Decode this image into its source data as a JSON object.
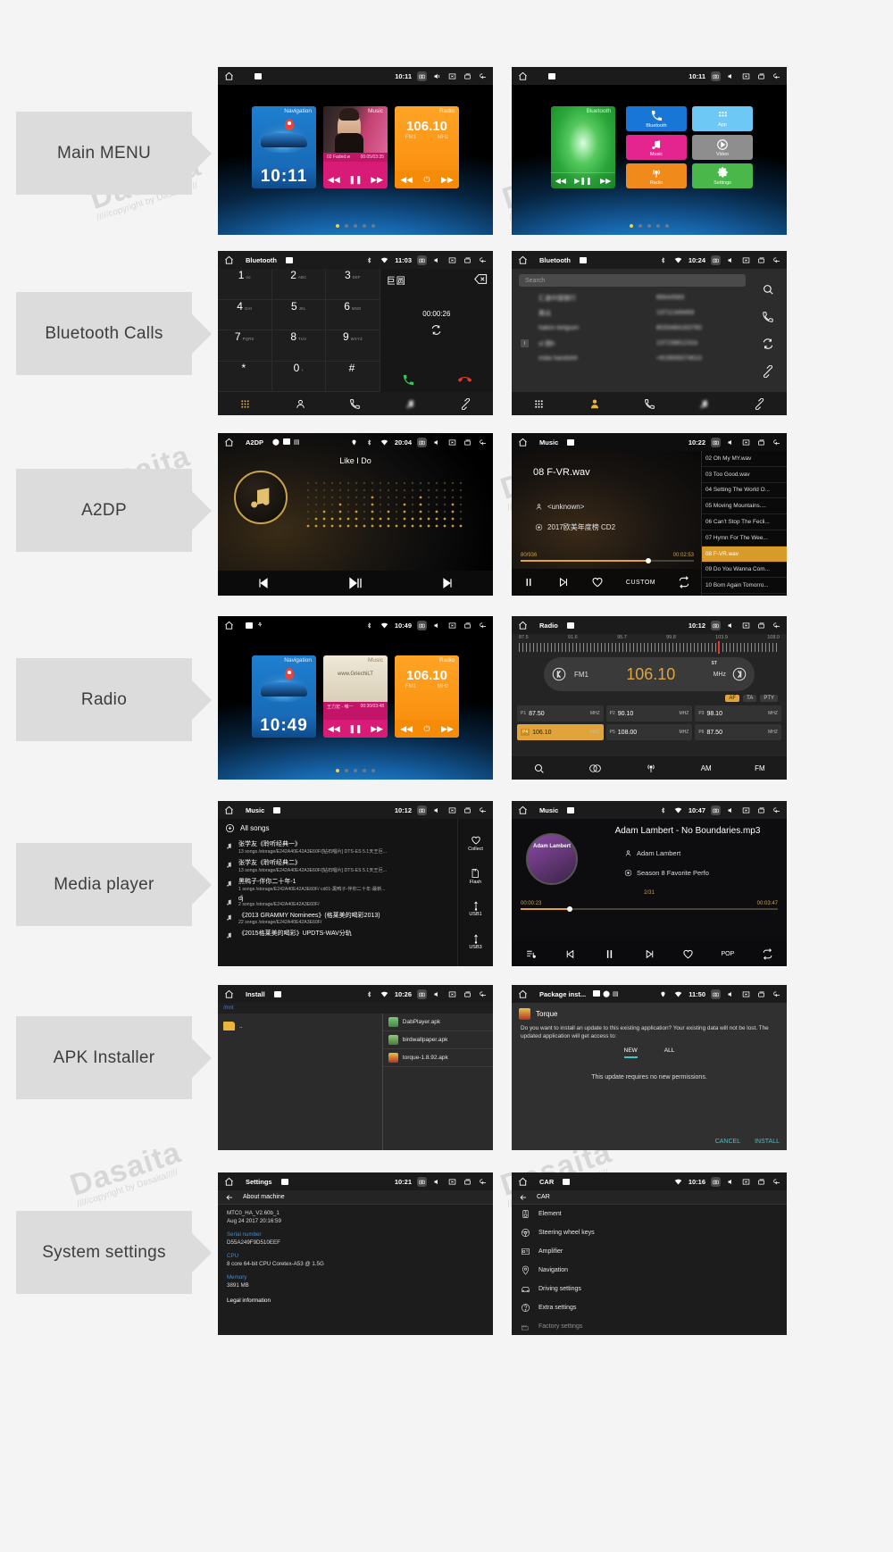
{
  "watermark": {
    "brand": "Dasaita",
    "note": "/////copyright by Dasaita/////"
  },
  "sections": [
    {
      "label": "Main MENU"
    },
    {
      "label": "Bluetooth Calls"
    },
    {
      "label": "A2DP"
    },
    {
      "label": "Radio"
    },
    {
      "label": "Media player"
    },
    {
      "label": "APK Installer"
    },
    {
      "label": "System settings"
    }
  ],
  "screens": {
    "main_menu_1": {
      "status": {
        "title": "",
        "clock": "10:11"
      },
      "widgets": {
        "navigation": {
          "label": "Navigation",
          "clock": "10:11"
        },
        "music": {
          "label": "Music",
          "track": "02 Faded.w",
          "time": "00:05/03:35"
        },
        "radio": {
          "label": "Radio",
          "freq": "106.10",
          "band": "FM1",
          "unit": "MHz"
        }
      },
      "pager": {
        "count": 5,
        "active": 1
      }
    },
    "main_menu_2": {
      "status": {
        "title": "",
        "clock": "10:11"
      },
      "bt_widget": {
        "label": "Bluetooth"
      },
      "tiles": [
        {
          "label": "Bluetooth",
          "icon": "phone-icon",
          "color": "#1877d6"
        },
        {
          "label": "App",
          "icon": "apps-icon",
          "color": "#6ec8f5"
        },
        {
          "label": "Music",
          "icon": "music-note-icon",
          "color": "#e5258f"
        },
        {
          "label": "Video",
          "icon": "play-circle-icon",
          "color": "#8e8e8e"
        },
        {
          "label": "Radio",
          "icon": "radio-waves-icon",
          "color": "#f08a1b"
        },
        {
          "label": "Settings",
          "icon": "gear-icon",
          "color": "#49b74a"
        }
      ],
      "pager": {
        "count": 5,
        "active": 1
      }
    },
    "bt_dialer": {
      "status": {
        "title": "Bluetooth",
        "clock": "11:03"
      },
      "keys": [
        {
          "d": "1",
          "s": "ᴏᴏ"
        },
        {
          "d": "2",
          "s": "ABC"
        },
        {
          "d": "3",
          "s": "DEF"
        },
        {
          "d": "4",
          "s": "GHI"
        },
        {
          "d": "5",
          "s": "JKL"
        },
        {
          "d": "6",
          "s": "MNO"
        },
        {
          "d": "7",
          "s": "PQRS"
        },
        {
          "d": "8",
          "s": "TUV"
        },
        {
          "d": "9",
          "s": "WXYZ"
        },
        {
          "d": "*",
          "s": ""
        },
        {
          "d": "0",
          "s": "+"
        },
        {
          "d": "#",
          "s": ""
        }
      ],
      "dialed": "巨圆",
      "timer": "00:00:26",
      "nav": [
        "dialpad-icon",
        "contacts-icon",
        "call-log-icon",
        "music-icon",
        "bt-link-icon"
      ]
    },
    "bt_contacts": {
      "status": {
        "title": "Bluetooth",
        "clock": "10:24"
      },
      "search_placeholder": "Search",
      "contacts": [
        {
          "name": "汇通中国银行",
          "number": "86644583"
        },
        {
          "name": "黄达",
          "number": "13711349469"
        },
        {
          "name": "hakim belgium",
          "number": "8033484163760"
        },
        {
          "name": "ul 图h",
          "number": "13715861231k",
          "index": "I"
        },
        {
          "name": "india handsfet",
          "number": "+819930074610"
        }
      ],
      "rail": [
        "search-icon",
        "call-icon",
        "sync-icon",
        "bt-link-icon"
      ],
      "nav": [
        "dialpad-icon",
        "contacts-icon",
        "call-log-icon",
        "music-icon",
        "bt-link-icon"
      ]
    },
    "a2dp": {
      "status": {
        "title": "A2DP",
        "clock": "20:04"
      },
      "song": "Like I Do",
      "controls": [
        "prev-icon",
        "play-pause-icon",
        "next-icon"
      ]
    },
    "a2dp_music": {
      "status": {
        "title": "Music",
        "clock": "10:22"
      },
      "track": "08 F-VR.wav",
      "artist": "<unknown>",
      "album": "2017欧美年度榜 CD2",
      "counter": "80/936",
      "time": "00:02:53",
      "controls": {
        "pause": "pause-icon",
        "next": "next-icon",
        "fav": "heart-icon",
        "eq": "CUSTOM",
        "repeat": "repeat-icon"
      },
      "playlist": [
        "02 Oh My MY.wav",
        "03 Too Good.wav",
        "04 Setting The World O...",
        "05 Moving Mountains....",
        "06 Can't Stop The Fecli...",
        "07 Hymn For The Wee...",
        "08 F-VR.wav",
        "09 Do You Wanna Com...",
        "10 Born Again Tomorro..."
      ],
      "playlist_selected": 6
    },
    "radio_home": {
      "status": {
        "title": "",
        "clock": "10:49"
      },
      "widgets": {
        "navigation": {
          "label": "Navigation",
          "clock": "10:49"
        },
        "music": {
          "label": "Music",
          "track": "王力宏 - 唯一",
          "time": "00:30/03:48"
        },
        "radio": {
          "label": "Radio",
          "freq": "106.10",
          "band": "FM1",
          "unit": "MHz"
        }
      },
      "pager": {
        "count": 5,
        "active": 1
      }
    },
    "radio": {
      "status": {
        "title": "Radio",
        "clock": "10:12"
      },
      "scale_ticks": [
        "87.5",
        "91.6",
        "95.7",
        "99.8",
        "103.9",
        "108.0"
      ],
      "band": "FM1",
      "frequency": "106.10",
      "unit": "MHz",
      "stereo": "ST",
      "chips": [
        {
          "label": "AF",
          "active": true
        },
        {
          "label": "TA",
          "active": false
        },
        {
          "label": "PTY",
          "active": false
        }
      ],
      "presets": [
        {
          "slot": "P1",
          "freq": "87.50",
          "unit": "MHZ",
          "active": false
        },
        {
          "slot": "P2",
          "freq": "90.10",
          "unit": "MHZ",
          "active": false
        },
        {
          "slot": "P3",
          "freq": "98.10",
          "unit": "MHZ",
          "active": false
        },
        {
          "slot": "P4",
          "freq": "106.10",
          "unit": "MHZ",
          "active": true
        },
        {
          "slot": "P5",
          "freq": "108.00",
          "unit": "MHZ",
          "active": false
        },
        {
          "slot": "P6",
          "freq": "87.50",
          "unit": "MHZ",
          "active": false
        }
      ],
      "bottom": [
        {
          "label": "",
          "icon": "search-icon"
        },
        {
          "label": "",
          "icon": "stereo-icon"
        },
        {
          "label": "",
          "icon": "antenna-icon"
        },
        {
          "label": "AM",
          "icon": ""
        },
        {
          "label": "FM",
          "icon": ""
        }
      ]
    },
    "media_list": {
      "status": {
        "title": "Music",
        "clock": "10:12"
      },
      "header": "All songs",
      "items": [
        {
          "title": "张学友《聆听经典一》",
          "sub": "13 songs /storage/E242A40E42A3E60F/[钻石唱片] DTS-ES 5.1天王巨..."
        },
        {
          "title": "张学友《聆听经典二》",
          "sub": "13 songs /storage/E242A40E42A3E60F/[钻石唱片] DTS-ES 5.1天王巨..."
        },
        {
          "title": "黑鸭子-伴你二十年-1",
          "sub": "1 songs /storage/E242A40E42A3E60F/ cd01-黑鸭子-伴你二十年-最新..."
        },
        {
          "title": "dj",
          "sub": "2 songs /storage/E242A40E42A3E60F/"
        },
        {
          "title": "《2013 GRAMMY Nominees》(格莱美的喝彩2013)",
          "sub": "22 songs /storage/E242A40E42A3E60F/"
        },
        {
          "title": "《2015格莱美的喝彩》UPDTS-WAV分轨",
          "sub": ""
        }
      ],
      "side": [
        {
          "label": "Collect",
          "icon": "heart-icon"
        },
        {
          "label": "Flash",
          "icon": "sdcard-icon"
        },
        {
          "label": "USB1",
          "icon": "usb-icon"
        },
        {
          "label": "USB3",
          "icon": "usb-icon"
        }
      ]
    },
    "media_player": {
      "status": {
        "title": "Music",
        "clock": "10:47"
      },
      "title": "Adam Lambert - No Boundaries.mp3",
      "artist": "Adam Lambert",
      "album": "Season 8 Favorite Perfo",
      "counter": "2/31",
      "elapsed": "00:00:23",
      "total": "00:03:47",
      "eq": "POP",
      "art_caption": "Adam Lambert"
    },
    "apk_installer": {
      "status": {
        "title": "Install",
        "clock": "10:26"
      },
      "breadcrumb": "/mnt",
      "left_items": [
        ".."
      ],
      "right_items": [
        {
          "name": "DabPlayer.apk",
          "icon": "apk-icon",
          "color": "#4fae4f"
        },
        {
          "name": "birdwallpaper.apk",
          "icon": "apk-icon",
          "color": "#5aa75a"
        },
        {
          "name": "torque-1.8.92.apk",
          "icon": "apk-icon",
          "color": "#d8a72a"
        }
      ]
    },
    "package_installer": {
      "status": {
        "title": "Package inst...",
        "clock": "11:50"
      },
      "app_name": "Torque",
      "message": "Do you want to install an update to this existing application? Your existing data will not be lost. The updated application will get access to:",
      "tabs": [
        {
          "label": "NEW",
          "active": true
        },
        {
          "label": "ALL",
          "active": false
        }
      ],
      "permissions_note": "This update requires no new permissions.",
      "buttons": [
        "CANCEL",
        "INSTALL"
      ]
    },
    "settings": {
      "status": {
        "title": "Settings",
        "clock": "10:21"
      },
      "page_title": "About machine",
      "entries": [
        {
          "key": "",
          "value": "MTC0_HA_V2.60b_1\nAug 24 2017 20:16:59"
        },
        {
          "key": "Serial number",
          "value": "D55A249F9D510EEF"
        },
        {
          "key": "CPU",
          "value": "8 core 64-bit CPU Coretex-A53 @ 1.5G"
        },
        {
          "key": "Memory",
          "value": "3891 MB"
        },
        {
          "key": "Legal information",
          "value": ""
        }
      ]
    },
    "car_settings": {
      "status": {
        "title": "CAR",
        "clock": "10:16"
      },
      "page_title": "CAR",
      "rows": [
        {
          "label": "Element",
          "icon": "speaker-icon"
        },
        {
          "label": "Steering wheel keys",
          "icon": "steering-icon"
        },
        {
          "label": "Amplifier",
          "icon": "amp-icon"
        },
        {
          "label": "Navigation",
          "icon": "nav-icon"
        },
        {
          "label": "Driving settings",
          "icon": "car-icon"
        },
        {
          "label": "Extra settings",
          "icon": "extra-icon"
        },
        {
          "label": "Factory settings",
          "icon": "factory-icon"
        }
      ]
    }
  }
}
